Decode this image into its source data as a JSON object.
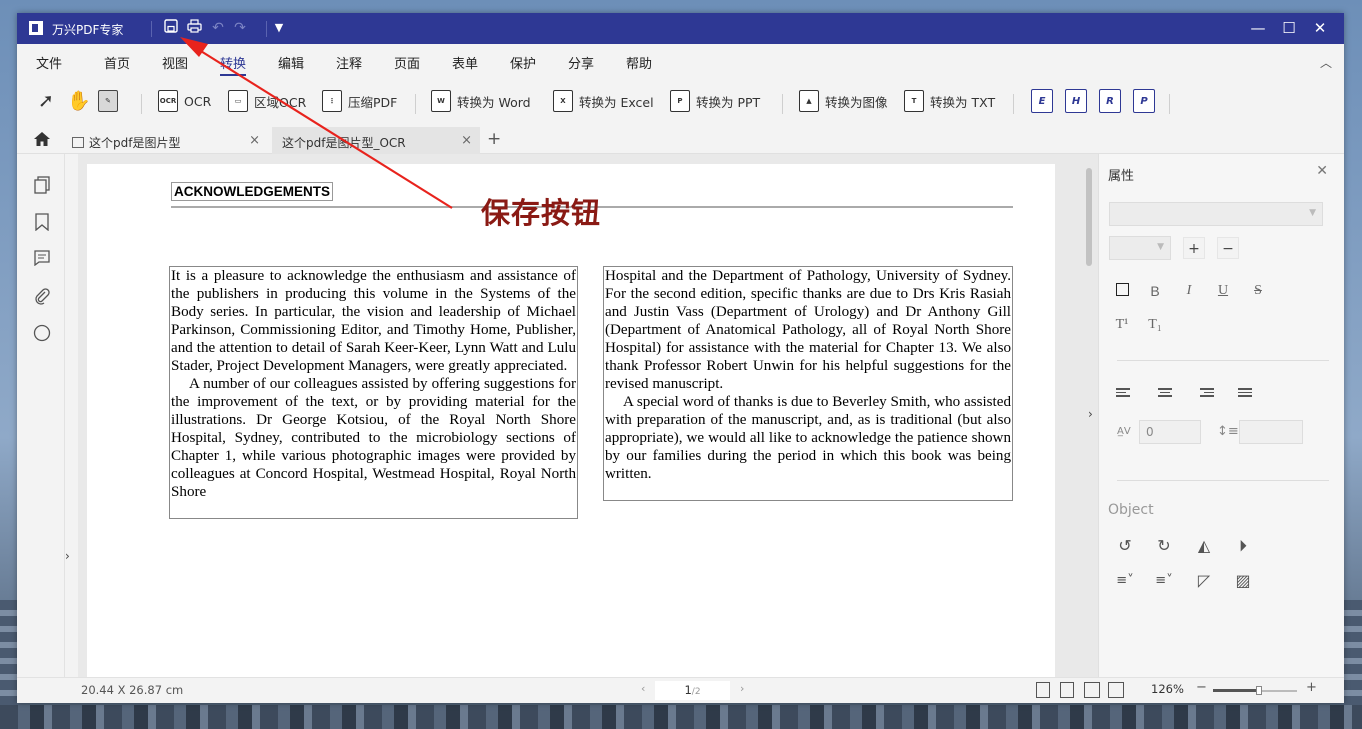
{
  "window": {
    "title": "万兴PDF专家"
  },
  "menu": [
    "文件",
    "首页",
    "视图",
    "转换",
    "编辑",
    "注释",
    "页面",
    "表单",
    "保护",
    "分享",
    "帮助"
  ],
  "menu_active": "转换",
  "toolbar": {
    "ocr": "OCR",
    "area_ocr": "区域OCR",
    "compress": "压缩PDF",
    "to_word": "转换为 Word",
    "to_excel": "转换为 Excel",
    "to_ppt": "转换为 PPT",
    "to_image": "转换为图像",
    "to_txt": "转换为 TXT",
    "format_icons": [
      "E",
      "H",
      "R",
      "P"
    ],
    "ocr_icon_text": "OCR"
  },
  "tabs": [
    {
      "label": "这个pdf是图片型",
      "active": false
    },
    {
      "label": "这个pdf是图片型_OCR",
      "active": true
    }
  ],
  "annotation": {
    "label": "保存按钮",
    "color": "#8a1a14"
  },
  "document": {
    "heading": "ACKNOWLEDGEMENTS",
    "left_col": [
      "It is a pleasure to acknowledge the enthusiasm and assistance of the publishers in producing this volume in the Systems of the Body series. In particular, the vision and leadership of Michael Parkinson, Commissioning Editor, and Timothy Home, Publisher, and the attention to detail of Sarah Keer-Keer, Lynn Watt and Lulu Stader, Project Development Managers, were greatly appreciated.",
      "A number of our colleagues assisted by offering suggestions for the improvement of the text, or by providing material for the illustrations. Dr George Kotsiou, of the Royal North Shore Hospital, Sydney, contributed to the microbiology sections of Chapter 1, while various photographic images were provided by colleagues at Concord Hospital, Westmead Hospital, Royal North Shore"
    ],
    "right_col": [
      "Hospital and the Department of Pathology, University of Sydney. For the second edition, specific thanks are due to Drs Kris Rasiah and Justin Vass (Department of Urology) and Dr Anthony Gill (Department of Anatomical Pathology, all of Royal North Shore Hospital) for assistance with the material for Chapter 13. We also thank Professor Robert Unwin for his helpful suggestions for the revised manuscript.",
      "A special word of thanks is due to Beverley Smith, who assisted with preparation of the manuscript, and, as is traditional (but also appropriate), we would all like to acknowledge the patience shown by our families during the period in which this book was being written."
    ]
  },
  "properties": {
    "title": "属性",
    "plus": "+",
    "minus": "−",
    "fmt": [
      "B",
      "I",
      "U",
      "S"
    ],
    "superscript": "T¹",
    "subscript": "T₁",
    "char_spacing": "0",
    "object_label": "Object"
  },
  "status": {
    "dimensions": "20.44 X 26.87 cm",
    "page_current": "1",
    "page_total": "/2",
    "zoom": "126%",
    "zoom_level": 0.55
  }
}
